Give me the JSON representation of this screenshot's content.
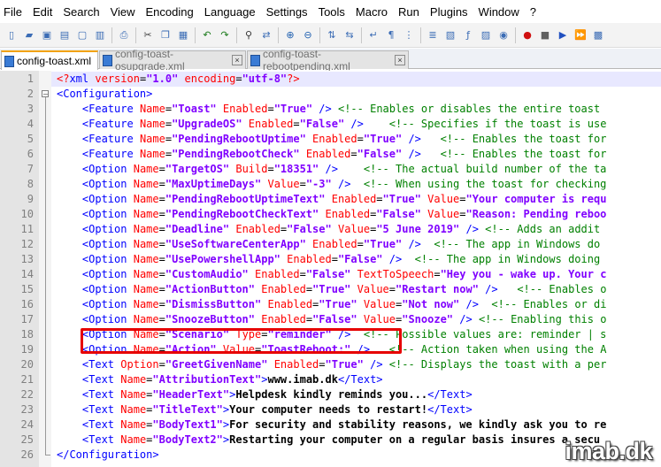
{
  "menu": [
    "File",
    "Edit",
    "Search",
    "View",
    "Encoding",
    "Language",
    "Settings",
    "Tools",
    "Macro",
    "Run",
    "Plugins",
    "Window",
    "?"
  ],
  "toolbar_icons": [
    "new-file-icon",
    "open-file-icon",
    "save-icon",
    "save-all-icon",
    "close-icon",
    "close-all-icon",
    "print-icon",
    "cut-icon",
    "copy-icon",
    "paste-icon",
    "undo-icon",
    "redo-icon",
    "find-icon",
    "replace-icon",
    "zoom-in-icon",
    "zoom-out-icon",
    "sync-vertical-icon",
    "sync-horizontal-icon",
    "word-wrap-icon",
    "show-all-chars-icon",
    "indent-guide-icon",
    "lang-icon",
    "doc-map-icon",
    "function-list-icon",
    "folder-workspace-icon",
    "monitor-icon",
    "record-macro-icon",
    "stop-macro-icon",
    "play-macro-icon",
    "run-macro-multiple-icon",
    "save-macro-icon"
  ],
  "tabs": [
    {
      "label": "config-toast.xml",
      "active": true
    },
    {
      "label": "config-toast-osupgrade.xml",
      "active": false
    },
    {
      "label": "config-toast-rebootpending.xml",
      "active": false
    }
  ],
  "lines": [
    {
      "n": "1",
      "html": "<span class='pi'>&lt;?</span><span class='tg'>xml</span> <span class='at'>version</span>=<span class='va'>\"1.0\"</span> <span class='at'>encoding</span>=<span class='va'>\"utf-8\"</span><span class='pi'>?&gt;</span>"
    },
    {
      "n": "2",
      "html": "<span class='tg'>&lt;Configuration&gt;</span>"
    },
    {
      "n": "3",
      "html": "    <span class='tg'>&lt;Feature</span> <span class='at'>Name</span>=<span class='va'>\"Toast\"</span> <span class='at'>Enabled</span>=<span class='va'>\"True\"</span> <span class='tg'>/&gt;</span> <span class='cm'>&lt;!-- Enables or disables the entire toast</span>"
    },
    {
      "n": "4",
      "html": "    <span class='tg'>&lt;Feature</span> <span class='at'>Name</span>=<span class='va'>\"UpgradeOS\"</span> <span class='at'>Enabled</span>=<span class='va'>\"False\"</span> <span class='tg'>/&gt;</span>    <span class='cm'>&lt;!-- Specifies if the toast is use</span>"
    },
    {
      "n": "5",
      "html": "    <span class='tg'>&lt;Feature</span> <span class='at'>Name</span>=<span class='va'>\"PendingRebootUptime\"</span> <span class='at'>Enabled</span>=<span class='va'>\"True\"</span> <span class='tg'>/&gt;</span>   <span class='cm'>&lt;!-- Enables the toast for</span>"
    },
    {
      "n": "6",
      "html": "    <span class='tg'>&lt;Feature</span> <span class='at'>Name</span>=<span class='va'>\"PendingRebootCheck\"</span> <span class='at'>Enabled</span>=<span class='va'>\"False\"</span> <span class='tg'>/&gt;</span>   <span class='cm'>&lt;!-- Enables the toast for</span>"
    },
    {
      "n": "7",
      "html": "    <span class='tg'>&lt;Option</span> <span class='at'>Name</span>=<span class='va'>\"TargetOS\"</span> <span class='at'>Build</span>=<span class='va'>\"18351\"</span> <span class='tg'>/&gt;</span>    <span class='cm'>&lt;!-- The actual build number of the ta</span>"
    },
    {
      "n": "8",
      "html": "    <span class='tg'>&lt;Option</span> <span class='at'>Name</span>=<span class='va'>\"MaxUptimeDays\"</span> <span class='at'>Value</span>=<span class='va'>\"-3\"</span> <span class='tg'>/&gt;</span>  <span class='cm'>&lt;!-- When using the toast for checking</span>"
    },
    {
      "n": "9",
      "html": "    <span class='tg'>&lt;Option</span> <span class='at'>Name</span>=<span class='va'>\"PendingRebootUptimeText\"</span> <span class='at'>Enabled</span>=<span class='va'>\"True\"</span> <span class='at'>Value</span>=<span class='va'>\"Your computer is requ</span>"
    },
    {
      "n": "10",
      "html": "    <span class='tg'>&lt;Option</span> <span class='at'>Name</span>=<span class='va'>\"PendingRebootCheckText\"</span> <span class='at'>Enabled</span>=<span class='va'>\"False\"</span> <span class='at'>Value</span>=<span class='va'>\"Reason: Pending reboo</span>"
    },
    {
      "n": "11",
      "html": "    <span class='tg'>&lt;Option</span> <span class='at'>Name</span>=<span class='va'>\"Deadline\"</span> <span class='at'>Enabled</span>=<span class='va'>\"False\"</span> <span class='at'>Value</span>=<span class='va'>\"5 June 2019\"</span> <span class='tg'>/&gt;</span> <span class='cm'>&lt;!-- Adds an addit</span>"
    },
    {
      "n": "12",
      "html": "    <span class='tg'>&lt;Option</span> <span class='at'>Name</span>=<span class='va'>\"UseSoftwareCenterApp\"</span> <span class='at'>Enabled</span>=<span class='va'>\"True\"</span> <span class='tg'>/&gt;</span>  <span class='cm'>&lt;!-- The app in Windows do</span>"
    },
    {
      "n": "13",
      "html": "    <span class='tg'>&lt;Option</span> <span class='at'>Name</span>=<span class='va'>\"UsePowershellApp\"</span> <span class='at'>Enabled</span>=<span class='va'>\"False\"</span> <span class='tg'>/&gt;</span>  <span class='cm'>&lt;!-- The app in Windows doing</span>"
    },
    {
      "n": "14",
      "html": "    <span class='tg'>&lt;Option</span> <span class='at'>Name</span>=<span class='va'>\"CustomAudio\"</span> <span class='at'>Enabled</span>=<span class='va'>\"False\"</span> <span class='at'>TextToSpeech</span>=<span class='va'>\"Hey you - wake up. Your c</span>"
    },
    {
      "n": "15",
      "html": "    <span class='tg'>&lt;Option</span> <span class='at'>Name</span>=<span class='va'>\"ActionButton\"</span> <span class='at'>Enabled</span>=<span class='va'>\"True\"</span> <span class='at'>Value</span>=<span class='va'>\"Restart now\"</span> <span class='tg'>/&gt;</span>   <span class='cm'>&lt;!-- Enables o</span>"
    },
    {
      "n": "16",
      "html": "    <span class='tg'>&lt;Option</span> <span class='at'>Name</span>=<span class='va'>\"DismissButton\"</span> <span class='at'>Enabled</span>=<span class='va'>\"True\"</span> <span class='at'>Value</span>=<span class='va'>\"Not now\"</span> <span class='tg'>/&gt;</span>  <span class='cm'>&lt;!-- Enables or di</span>"
    },
    {
      "n": "17",
      "html": "    <span class='tg'>&lt;Option</span> <span class='at'>Name</span>=<span class='va'>\"SnoozeButton\"</span> <span class='at'>Enabled</span>=<span class='va'>\"False\"</span> <span class='at'>Value</span>=<span class='va'>\"Snooze\"</span> <span class='tg'>/&gt;</span> <span class='cm'>&lt;!-- Enabling this o</span>"
    },
    {
      "n": "18",
      "html": "    <span class='tg'>&lt;Option</span> <span class='at'>Name</span>=<span class='va'>\"Scenario\"</span> <span class='at'>Type</span>=<span class='va'>\"reminder\"</span> <span class='tg'>/&gt;</span>  <span class='cm'>&lt;!-- Possible values are: reminder | s</span>"
    },
    {
      "n": "19",
      "html": "    <span class='tg'>&lt;Option</span> <span class='at'>Name</span>=<span class='va'>\"Action\"</span> <span class='at'>Value</span>=<span class='va'>\"ToastReboot:\"</span> <span class='tg'>/&gt;</span>   <span class='cm'>&lt;!-- Action taken when using the A</span>"
    },
    {
      "n": "20",
      "html": "    <span class='tg'>&lt;Text</span> <span class='at'>Option</span>=<span class='va'>\"GreetGivenName\"</span> <span class='at'>Enabled</span>=<span class='va'>\"True\"</span> <span class='tg'>/&gt;</span> <span class='cm'>&lt;!-- Displays the toast with a per</span>"
    },
    {
      "n": "21",
      "html": "    <span class='tg'>&lt;Text</span> <span class='at'>Name</span>=<span class='va'>\"AttributionText\"</span><span class='tg'>&gt;</span><span class='tx'>www.imab.dk</span><span class='tg'>&lt;/Text&gt;</span>"
    },
    {
      "n": "22",
      "html": "    <span class='tg'>&lt;Text</span> <span class='at'>Name</span>=<span class='va'>\"HeaderText\"</span><span class='tg'>&gt;</span><span class='tx'>Helpdesk kindly reminds you...</span><span class='tg'>&lt;/Text&gt;</span>"
    },
    {
      "n": "23",
      "html": "    <span class='tg'>&lt;Text</span> <span class='at'>Name</span>=<span class='va'>\"TitleText\"</span><span class='tg'>&gt;</span><span class='tx'>Your computer needs to restart!</span><span class='tg'>&lt;/Text&gt;</span>"
    },
    {
      "n": "24",
      "html": "    <span class='tg'>&lt;Text</span> <span class='at'>Name</span>=<span class='va'>\"BodyText1\"</span><span class='tg'>&gt;</span><span class='tx'>For security and stability reasons, we kindly ask you to re</span>"
    },
    {
      "n": "25",
      "html": "    <span class='tg'>&lt;Text</span> <span class='at'>Name</span>=<span class='va'>\"BodyText2\"</span><span class='tg'>&gt;</span><span class='tx'>Restarting your computer on a regular basis insures a secu</span>"
    },
    {
      "n": "26",
      "html": "<span class='tg'>&lt;/Configuration&gt;</span>"
    }
  ],
  "current_line": "1",
  "watermark": "imab.dk"
}
